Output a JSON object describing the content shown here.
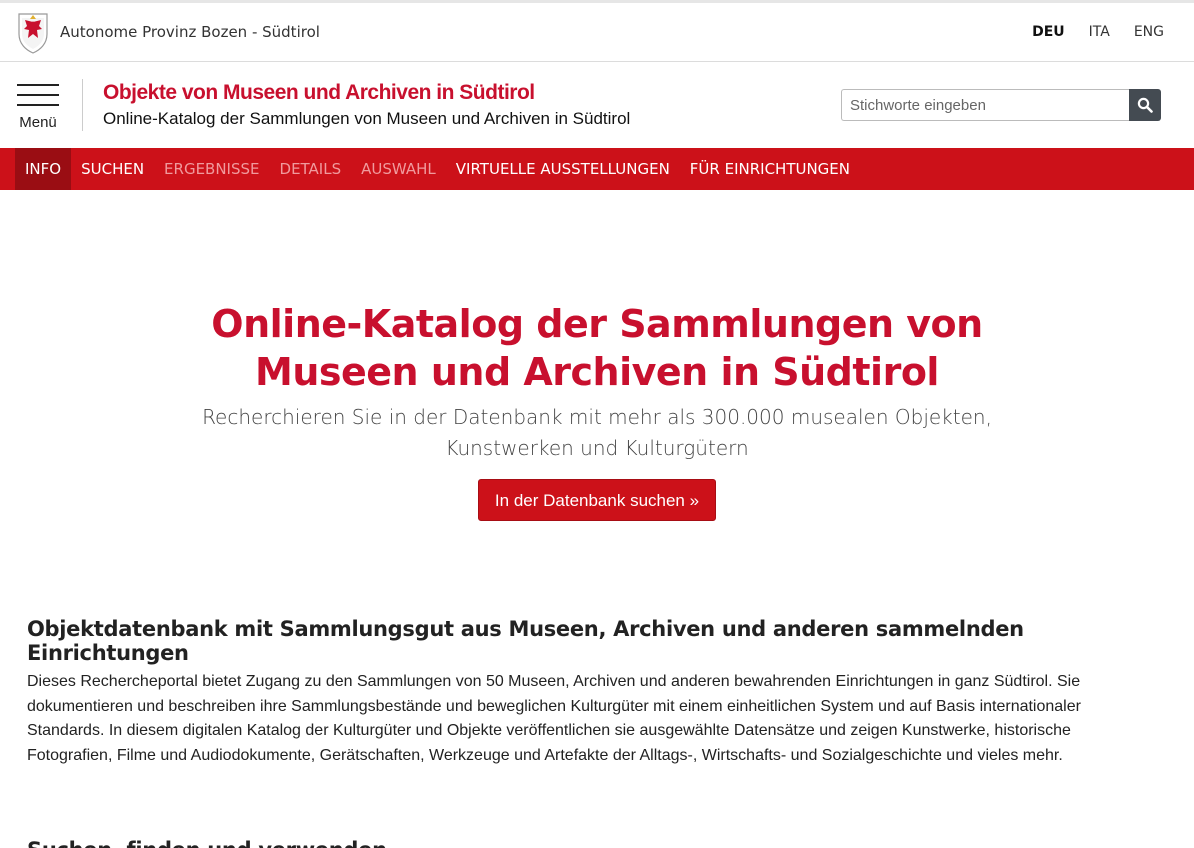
{
  "topbar": {
    "province": "Autonome Provinz Bozen - Südtirol",
    "languages": [
      {
        "label": "DEU",
        "active": true
      },
      {
        "label": "ITA",
        "active": false
      },
      {
        "label": "ENG",
        "active": false
      }
    ]
  },
  "header": {
    "menu_label": "Menü",
    "title": "Objekte von Museen und Archiven in Südtirol",
    "subtitle": "Online-Katalog der Sammlungen von Museen und Archiven in Südtirol",
    "search_placeholder": "Stichworte eingeben"
  },
  "nav": {
    "items": [
      {
        "label": "INFO",
        "state": "active"
      },
      {
        "label": "SUCHEN",
        "state": "normal"
      },
      {
        "label": "ERGEBNISSE",
        "state": "disabled"
      },
      {
        "label": "DETAILS",
        "state": "disabled"
      },
      {
        "label": "AUSWAHL",
        "state": "disabled"
      },
      {
        "label": "VIRTUELLE AUSSTELLUNGEN",
        "state": "normal"
      },
      {
        "label": "FÜR EINRICHTUNGEN",
        "state": "normal"
      }
    ]
  },
  "hero": {
    "title": "Online-Katalog der Sammlungen von Museen und Archiven in Südtirol",
    "text": "Recherchieren Sie in der Datenbank mit mehr als 300.000 musealen Objekten, Kunstwerken und Kulturgütern",
    "button": "In der Datenbank suchen »"
  },
  "sections": [
    {
      "heading": "Objektdatenbank mit Sammlungsgut aus Museen, Archiven und anderen sammelnden Einrichtungen",
      "body": "Dieses Rechercheportal bietet Zugang zu den Sammlungen von 50 Museen, Archiven und anderen bewahrenden Einrichtungen in ganz Südtirol. Sie dokumentieren und beschreiben ihre Sammlungsbestände und beweglichen Kulturgüter mit einem einheitlichen System und auf Basis internationaler Standards. In diesem digitalen Katalog der Kulturgüter und Objekte veröffentlichen sie ausgewählte Datensätze und zeigen Kunstwerke, historische Fotografien, Filme und Audiodokumente, Gerätschaften, Werkzeuge und Artefakte der Alltags-, Wirtschafts- und Sozialgeschichte und vieles mehr."
    },
    {
      "heading": "Suchen, finden und verwenden",
      "body": ""
    }
  ],
  "colors": {
    "brand": "#cc1119",
    "nav_active": "#9a0d13",
    "nav_disabled": "#f09a9d"
  }
}
